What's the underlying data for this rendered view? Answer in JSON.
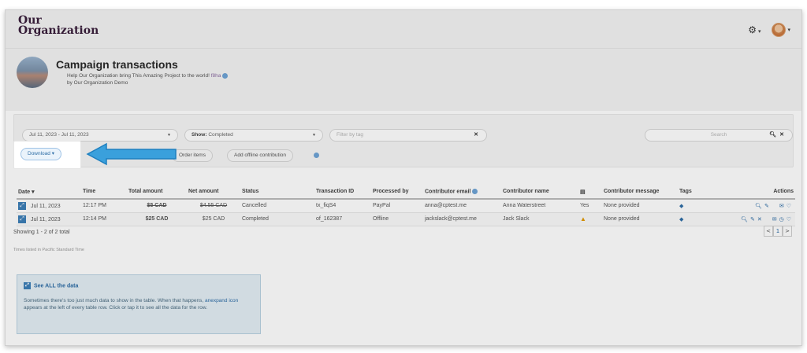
{
  "header": {
    "logo_line1": "Our",
    "logo_line2": "Organization",
    "settings_icon": "gear-icon",
    "user_icon": "avatar"
  },
  "campaign": {
    "title": "Campaign transactions",
    "subtitle_text": "Help Our Organization bring This Amazing Project to the world!",
    "subtitle_link": "f8ha",
    "by_line": "by Our Organization Demo"
  },
  "filters": {
    "date_range": "Jul 11, 2023 - Jul 11, 2023",
    "show_label": "Show:",
    "show_value": "Completed",
    "tag_placeholder": "Filter by tag",
    "search_placeholder": "Search",
    "download_label": "Download",
    "order_items_label": "Order items",
    "add_offline_label": "Add offline contribution"
  },
  "table": {
    "headers": [
      "Date",
      "Time",
      "Total amount",
      "Net amount",
      "Status",
      "Transaction ID",
      "Processed by",
      "Contributor email",
      "Contributor name",
      "",
      "Contributor message",
      "Tags",
      "Actions"
    ],
    "rows": [
      {
        "date": "Jul 11, 2023",
        "time": "12:17 PM",
        "total": "$5 CAD",
        "net": "$4.55 CAD",
        "status": "Cancelled",
        "txid": "tx_fiqS4",
        "processed": "PayPal",
        "email": "anna@cptest.me",
        "name": "Anna Waterstreet",
        "flag": "Yes",
        "message": "None provided"
      },
      {
        "date": "Jul 11, 2023",
        "time": "12:14 PM",
        "total": "$25 CAD",
        "net": "$25 CAD",
        "status": "Completed",
        "txid": "of_162387",
        "processed": "Offline",
        "email": "jackslack@cptest.me",
        "name": "Jack Slack",
        "flag": "warning",
        "message": "None provided"
      }
    ]
  },
  "footer": {
    "showing": "Showing 1 - 2 of 2 total",
    "timezone": "Times listed in Pacific Standard Time",
    "page_prev": "<",
    "page_current": "1",
    "page_next": ">"
  },
  "tip": {
    "title": "See ALL the data",
    "body_1": "Sometimes there's too just much data to show in the table. When that happens,",
    "body_hl": "anexpand icon",
    "body_2": "appears at the left of every table row. Click or tap it to see all the data for the row."
  },
  "colors": {
    "accent": "#2f6ea7",
    "arrow": "#3aa0dc",
    "logo": "#3a1f3c"
  }
}
